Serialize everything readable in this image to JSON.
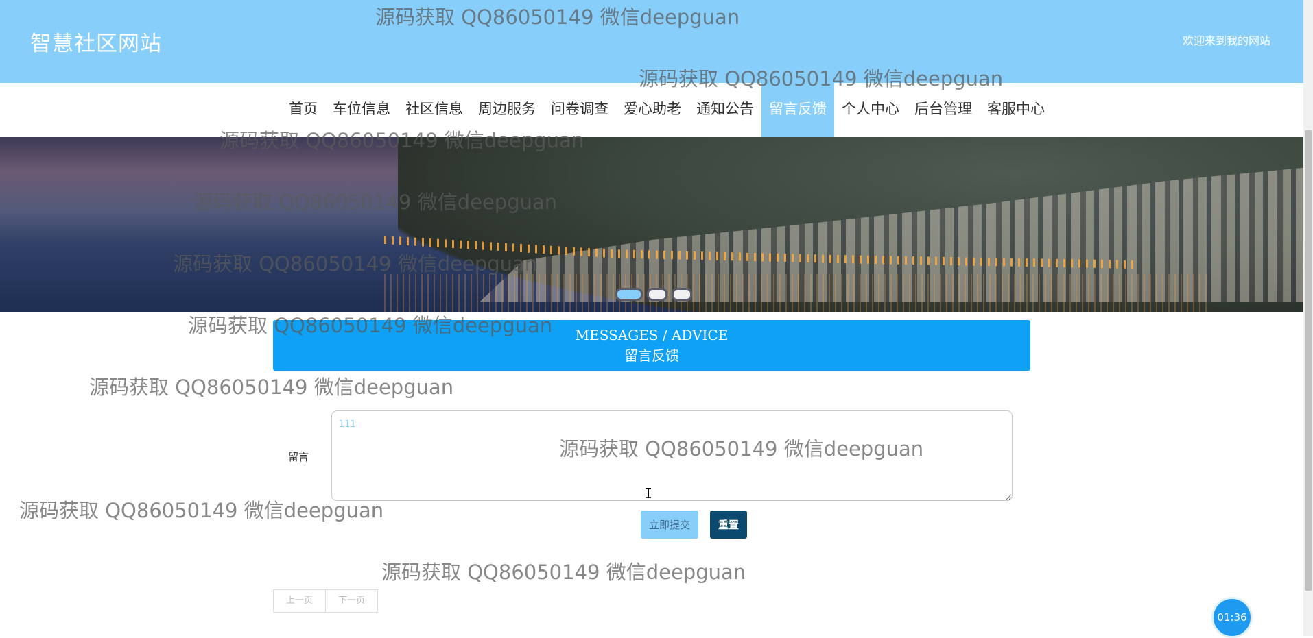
{
  "header": {
    "site_title": "智慧社区网站",
    "welcome": "欢迎来到我的网站"
  },
  "nav": {
    "items": [
      "首页",
      "车位信息",
      "社区信息",
      "周边服务",
      "问卷调查",
      "爱心助老",
      "通知公告",
      "留言反馈",
      "个人中心",
      "后台管理",
      "客服中心"
    ],
    "active": "留言反馈"
  },
  "banner": {
    "slide_count": 3,
    "active_slide": 1
  },
  "section": {
    "title_en": "MESSAGES / ADVICE",
    "title_cn": "留言反馈"
  },
  "form": {
    "message_label": "留言",
    "message_value": "111",
    "submit_label": "立即提交",
    "reset_label": "重置"
  },
  "pager": {
    "prev_label": "上一页",
    "next_label": "下一页"
  },
  "timer": "01:36",
  "watermark": "源码获取 QQ86050149 微信deepguan",
  "colors": {
    "header_bg": "#87cefa",
    "section_bg": "#0ea1f5",
    "reset_bg": "#0b4a6e"
  }
}
